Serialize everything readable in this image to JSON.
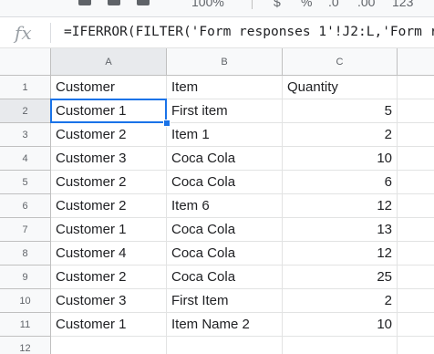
{
  "toolbar": {
    "zoom_partial": "100%",
    "percent_label": "%",
    "decrease_decimals_label": ".0",
    "increase_decimals_label": ".00",
    "more_formats_label": "123"
  },
  "formula_bar": {
    "fx_label": "fx",
    "formula": "=IFERROR(FILTER('Form responses 1'!J2:L,'Form r"
  },
  "sheet": {
    "selected_cell": "A2",
    "columns": [
      "A",
      "B",
      "C"
    ],
    "row_numbers": [
      "1",
      "2",
      "3",
      "4",
      "5",
      "6",
      "7",
      "8",
      "9",
      "10",
      "11",
      "12"
    ],
    "rows": [
      [
        "Customer",
        "Item",
        "Quantity"
      ],
      [
        "Customer 1",
        "First item",
        "5"
      ],
      [
        "Customer 2",
        "Item 1",
        "2"
      ],
      [
        "Customer 3",
        "Coca Cola",
        "10"
      ],
      [
        "Customer 2",
        "Coca Cola",
        "6"
      ],
      [
        "Customer 2",
        "Item 6",
        "12"
      ],
      [
        "Customer 1",
        "Coca Cola",
        "13"
      ],
      [
        "Customer 4",
        "Coca Cola",
        "12"
      ],
      [
        "Customer 2",
        "Coca Cola",
        "25"
      ],
      [
        "Customer 3",
        "First Item",
        "2"
      ],
      [
        "Customer 1",
        "Item Name 2",
        "10"
      ],
      [
        "",
        "",
        ""
      ]
    ]
  }
}
